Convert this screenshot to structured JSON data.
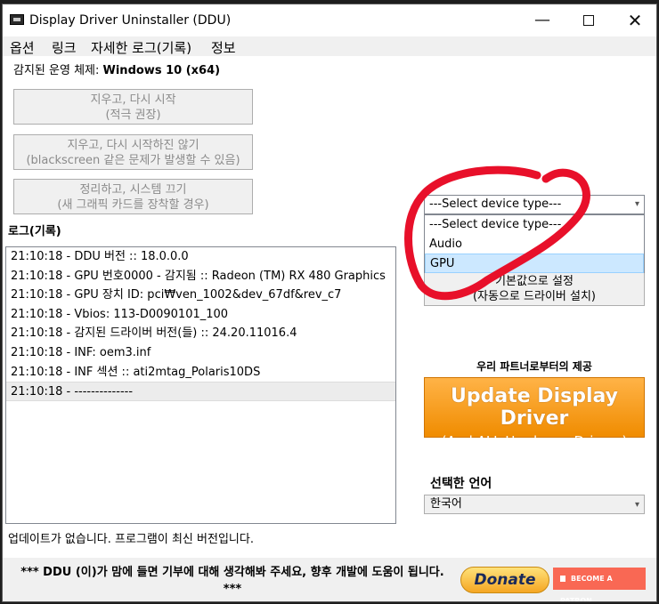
{
  "window": {
    "title": "Display Driver Uninstaller (DDU)",
    "minimize_glyph": "—",
    "close_glyph": "✕"
  },
  "menu": [
    "옵션",
    "링크",
    "자세한 로그(기록)",
    "정보"
  ],
  "os": {
    "label": "감지된 운영 체제:",
    "value": "Windows 10 (x64)"
  },
  "actions": [
    {
      "line1": "지우고, 다시 시작",
      "line2": "(적극 권장)"
    },
    {
      "line1": "지우고, 다시 시작하진 않기",
      "line2": "(blackscreen 같은 문제가 발생할 수 있음)"
    },
    {
      "line1": "정리하고, 시스템 끄기",
      "line2": "(새 그래픽 카드를 장착할 경우)"
    }
  ],
  "log": {
    "label": "로그(기록)",
    "rows": [
      "21:10:18 - DDU 버전 :: 18.0.0.0",
      "21:10:18 - GPU 번호0000 - 감지됨 :: Radeon (TM) RX 480 Graphics",
      "21:10:18 - GPU 장치 ID: pci₩ven_1002&dev_67df&rev_c7",
      "21:10:18 - Vbios: 113-D0090101_100",
      "21:10:18 - 감지된 드라이버 버전(들) :: 24.20.11016.4",
      "21:10:18 - INF: oem3.inf",
      "21:10:18 - INF 섹션 :: ati2mtag_Polaris10DS",
      "21:10:18 - --------------"
    ]
  },
  "status": "업데이트가 없습니다.  프로그램이 최신 버전입니다.",
  "device_select": {
    "value": "---Select device type---",
    "options": [
      "---Select device type---",
      "Audio",
      "GPU"
    ]
  },
  "right_button": {
    "line1": "기본값으로 설정",
    "line2": "(자동으로 드라이버 설치)"
  },
  "partner": {
    "label": "우리 파트너로부터의 제공",
    "ad_main": "Update Display Driver",
    "ad_sub": "(And ALL Hardware Drivers)"
  },
  "language": {
    "label": "선택한 언어",
    "value": "한국어"
  },
  "bottom": {
    "text": "*** DDU (이)가 맘에 들면 기부에 대해 생각해봐 주세요, 향후 개발에 도움이 됩니다. ***",
    "donate": "Donate",
    "patron": "BECOME A PATRON"
  },
  "colors": {
    "accent_marker": "#e8102a",
    "ad_orange": "#f39200",
    "patron": "#f96854"
  }
}
